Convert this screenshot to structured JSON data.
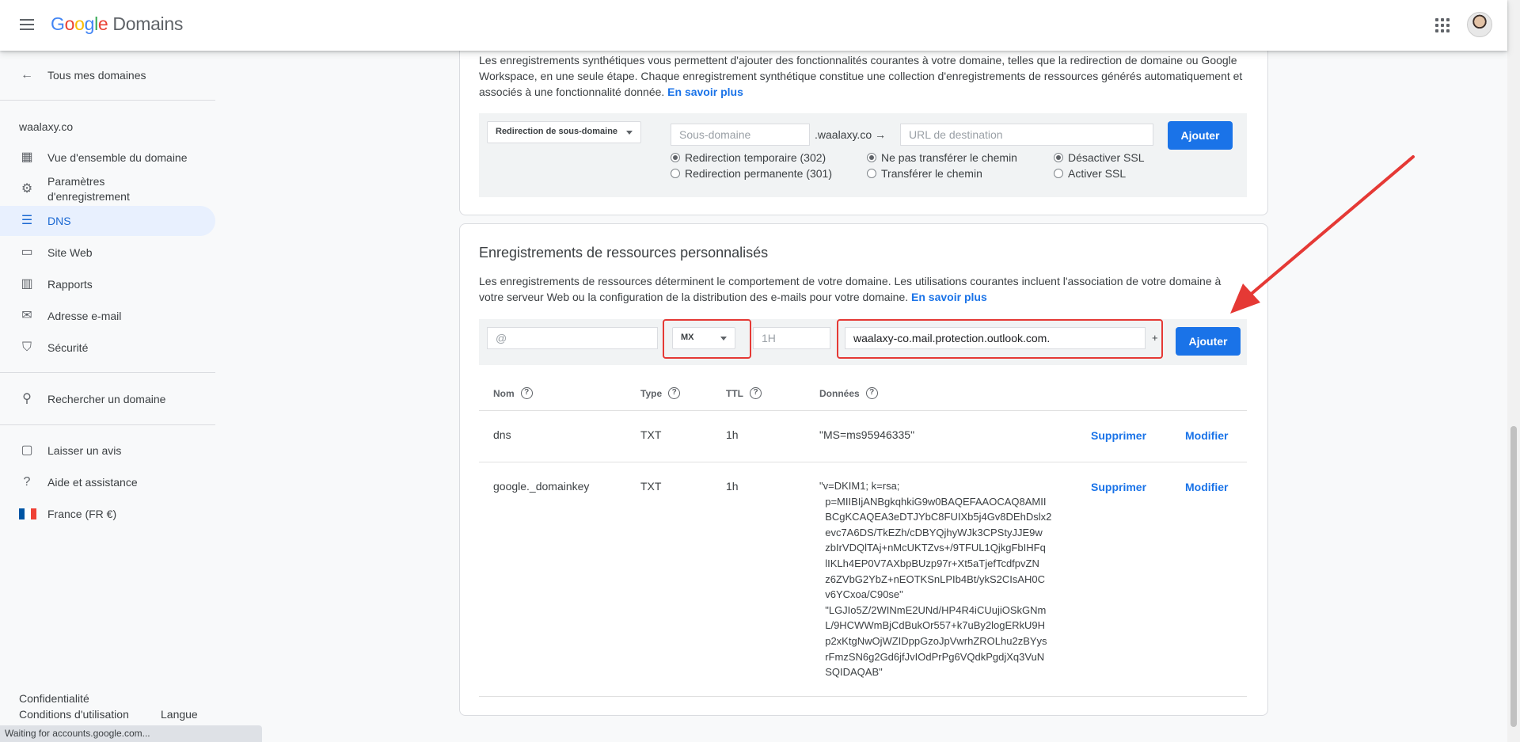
{
  "header": {
    "logo_google": [
      "G",
      "o",
      "o",
      "g",
      "l",
      "e"
    ],
    "logo_product": "Domains"
  },
  "sidebar": {
    "back_label": "Tous mes domaines",
    "domain": "waalaxy.co",
    "items": [
      {
        "label": "Vue d'ensemble du domaine",
        "icon": "dashboard-icon"
      },
      {
        "label": "Paramètres d'enregistrement",
        "icon": "gear-icon"
      },
      {
        "label": "DNS",
        "icon": "dns-icon"
      },
      {
        "label": "Site Web",
        "icon": "web-icon"
      },
      {
        "label": "Rapports",
        "icon": "chart-icon"
      },
      {
        "label": "Adresse e-mail",
        "icon": "mail-icon"
      },
      {
        "label": "Sécurité",
        "icon": "shield-icon"
      }
    ],
    "search_label": "Rechercher un domaine",
    "feedback_label": "Laisser un avis",
    "help_label": "Aide et assistance",
    "region_label": "France (FR €)",
    "privacy_label": "Confidentialité",
    "terms_label": "Conditions d'utilisation",
    "language_label": "Langue"
  },
  "status_bar": "Waiting for accounts.google.com...",
  "synthetic": {
    "description": "Les enregistrements synthétiques vous permettent d'ajouter des fonctionnalités courantes à votre domaine, telles que la redirection de domaine ou Google Workspace, en une seule étape. Chaque enregistrement synthétique constitue une collection d'enregistrements de ressources générés automatiquement et associés à une fonctionnalité donnée.",
    "learn_more": "En savoir plus",
    "type_select": "Redirection de sous-domaine",
    "subdomain_placeholder": "Sous-domaine",
    "domain_suffix": ".waalaxy.co →",
    "url_placeholder": "URL de destination",
    "add_label": "Ajouter",
    "radio_redirect": [
      "Redirection temporaire (302)",
      "Redirection permanente (301)"
    ],
    "radio_path": [
      "Ne pas transférer le chemin",
      "Transférer le chemin"
    ],
    "radio_ssl": [
      "Désactiver SSL",
      "Activer SSL"
    ]
  },
  "custom": {
    "title": "Enregistrements de ressources personnalisés",
    "description": "Les enregistrements de ressources déterminent le comportement de votre domaine. Les utilisations courantes incluent l'association de votre domaine à votre serveur Web ou la configuration de la distribution des e-mails pour votre domaine.",
    "learn_more": "En savoir plus",
    "name_placeholder": "@",
    "type_value": "MX",
    "ttl_placeholder": "1H",
    "data_value": "waalaxy-co.mail.protection.outlook.com.",
    "plus": "+",
    "add_label": "Ajouter",
    "columns": [
      "Nom",
      "Type",
      "TTL",
      "Données"
    ],
    "rows": [
      {
        "name": "dns",
        "type": "TXT",
        "ttl": "1h",
        "data": "\"MS=ms95946335\"",
        "delete": "Supprimer",
        "edit": "Modifier"
      },
      {
        "name": "google._domainkey",
        "type": "TXT",
        "ttl": "1h",
        "data": "\"v=DKIM1; k=rsa;\n  p=MIIBIjANBgkqhkiG9w0BAQEFAAOCAQ8AMII\n  BCgKCAQEA3eDTJYbC8FUIXb5j4Gv8DEhDslx2\n  evc7A6DS/TkEZh/cDBYQjhyWJk3CPStyJJE9w\n  zbIrVDQlTAj+nMcUKTZvs+/9TFUL1QjkgFbIHFq\n  lIKLh4EP0V7AXbpBUzp97r+Xt5aTjefTcdfpvZN\n  z6ZVbG2YbZ+nEOTKSnLPIb4Bt/ykS2CIsAH0C\n  v6YCxoa/C90se\"\n  \"LGJIo5Z/2WINmE2UNd/HP4R4iCUujiOSkGNm\n  L/9HCWWmBjCdBukOr557+k7uBy2logERkU9H\n  p2xKtgNwOjWZIDppGzoJpVwrhZROLhu2zBYys\n  rFmzSN6g2Gd6jfJvIOdPrPg6VQdkPgdjXq3VuN\n  SQIDAQAB\"",
        "delete": "Supprimer",
        "edit": "Modifier"
      }
    ]
  },
  "colors": {
    "accent": "#1a73e8",
    "highlight": "#e53935"
  }
}
